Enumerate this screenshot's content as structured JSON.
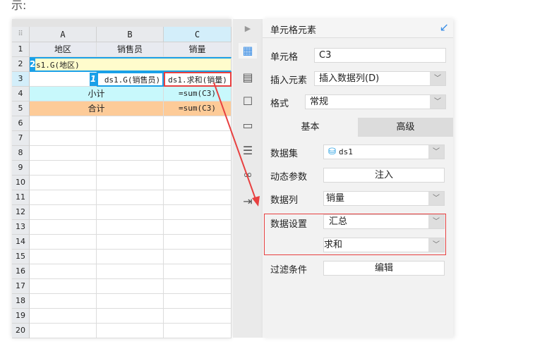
{
  "caption": "示:",
  "grid": {
    "columns": [
      "A",
      "B",
      "C"
    ],
    "rows": [
      "1",
      "2",
      "3",
      "4",
      "5",
      "6",
      "7",
      "8",
      "9",
      "10",
      "11",
      "12",
      "13",
      "14",
      "15",
      "16",
      "17",
      "18",
      "19",
      "20"
    ],
    "r1": [
      "地区",
      "销售员",
      "销量"
    ],
    "r2a": "s1.G(地区)",
    "r2badge": "2",
    "r3b": "ds1.G(销售员)",
    "r3badge": "1",
    "r3c": "ds1.求和(销量)",
    "r4ab": "小计",
    "r4c": "=sum(C3)",
    "r5ab": "合计",
    "r5c": "=sum(C3)"
  },
  "panel": {
    "title": "单元格元素",
    "cell_label": "单元格",
    "cell_value": "C3",
    "insert_label": "插入元素",
    "insert_value": "插入数据列(D)",
    "format_label": "格式",
    "format_value": "常规",
    "tabs": [
      "基本",
      "高级"
    ],
    "dataset_label": "数据集",
    "dataset_value": "ds1",
    "param_label": "动态参数",
    "param_btn": "注入",
    "column_label": "数据列",
    "column_value": "销量",
    "setting_label": "数据设置",
    "setting_value": "汇总",
    "agg_value": "求和",
    "filter_label": "过滤条件",
    "filter_btn": "编辑"
  },
  "colors": {
    "accent": "#1aa0e8",
    "highlight": "#e84040",
    "subtotal": "#c8f8fc",
    "total": "#fdcb98",
    "group": "#fffccc"
  }
}
